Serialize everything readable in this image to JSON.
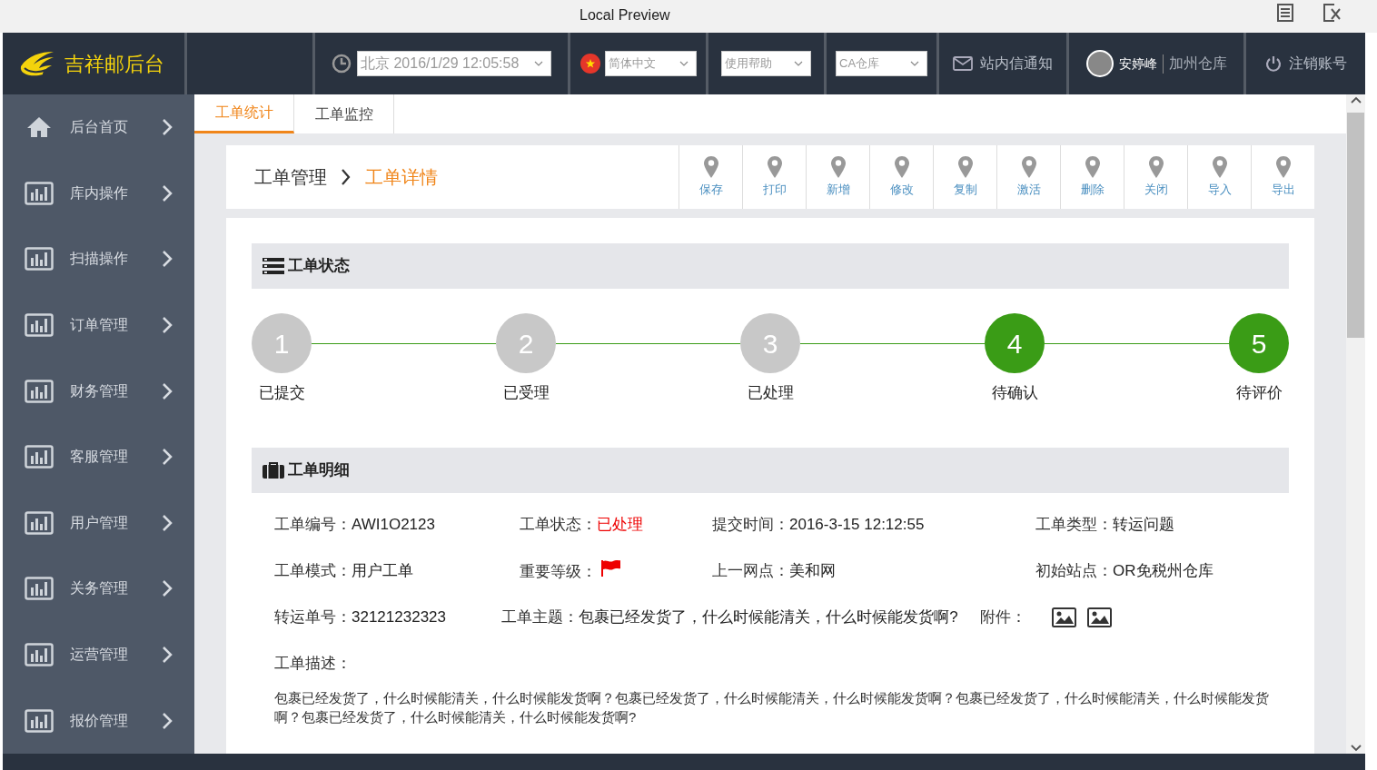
{
  "window": {
    "title": "Local Preview"
  },
  "header": {
    "brand": "吉祥邮后台",
    "datetime": "北京 2016/1/29 12:05:58",
    "language": "简体中文",
    "help": "使用帮助",
    "warehouse": "CA仓库",
    "notice": "站内信通知",
    "user": "安婷峰",
    "user_warehouse": "加州仓库",
    "logout": "注销账号"
  },
  "sidebar": {
    "items": [
      {
        "label": "后台首页",
        "kind": "home"
      },
      {
        "label": "库内操作",
        "kind": "chart"
      },
      {
        "label": "扫描操作",
        "kind": "chart"
      },
      {
        "label": "订单管理",
        "kind": "chart"
      },
      {
        "label": "财务管理",
        "kind": "chart"
      },
      {
        "label": "客服管理",
        "kind": "chart"
      },
      {
        "label": "用户管理",
        "kind": "chart"
      },
      {
        "label": "关务管理",
        "kind": "chart"
      },
      {
        "label": "运营管理",
        "kind": "chart"
      },
      {
        "label": "报价管理",
        "kind": "chart"
      }
    ]
  },
  "tabs": [
    {
      "label": "工单统计",
      "selected": true
    },
    {
      "label": "工单监控",
      "selected": false
    }
  ],
  "breadcrumb": [
    "工单管理",
    "工单详情"
  ],
  "toolbar": [
    "保存",
    "打印",
    "新增",
    "修改",
    "复制",
    "激活",
    "删除",
    "关闭",
    "导入",
    "导出"
  ],
  "status_section": {
    "title": "工单状态",
    "steps": [
      {
        "number": "1",
        "label": "已提交",
        "active": false
      },
      {
        "number": "2",
        "label": "已受理",
        "active": false
      },
      {
        "number": "3",
        "label": "已处理",
        "active": false
      },
      {
        "number": "4",
        "label": "待确认",
        "active": true
      },
      {
        "number": "5",
        "label": "待评价",
        "active": true
      }
    ]
  },
  "detail_section": {
    "title": "工单明细",
    "rows": [
      [
        {
          "label": "工单编号：",
          "kind": "text",
          "value": "AWI1O2123",
          "highlight": false
        },
        {
          "label": "工单状态：",
          "kind": "text",
          "value": "已处理",
          "highlight": true
        },
        {
          "label": "提交时间：",
          "kind": "text",
          "value": "2016-3-15 12:12:55",
          "highlight": false
        },
        {
          "label": "工单类型：",
          "kind": "text",
          "value": "转运问题",
          "highlight": false
        }
      ],
      [
        {
          "label": "工单模式：",
          "kind": "text",
          "value": "用户工单",
          "highlight": false
        },
        {
          "label": "重要等级：",
          "kind": "flag"
        },
        {
          "label": "上一网点：",
          "kind": "text",
          "value": "美和网",
          "highlight": false
        },
        {
          "label": "初始站点：",
          "kind": "text",
          "value": "OR免税州仓库",
          "highlight": false
        }
      ],
      [
        {
          "label": "转运单号：",
          "kind": "text",
          "value": "32121232323",
          "highlight": false
        },
        {
          "label": "工单主题：",
          "kind": "text",
          "value": "包裹已经发货了，什么时候能清关，什么时候能发货啊?",
          "highlight": false
        },
        {
          "label": "附件：",
          "kind": "attachments"
        }
      ]
    ],
    "description_label": "工单描述：",
    "description": "包裹已经发货了，什么时候能清关，什么时候能发货啊？包裹已经发货了，什么时候能清关，什么时候能发货啊？包裹已经发货了，什么时候能清关，什么时候能发货啊？包裹已经发货了，什么时候能清关，什么时候能发货啊?"
  }
}
